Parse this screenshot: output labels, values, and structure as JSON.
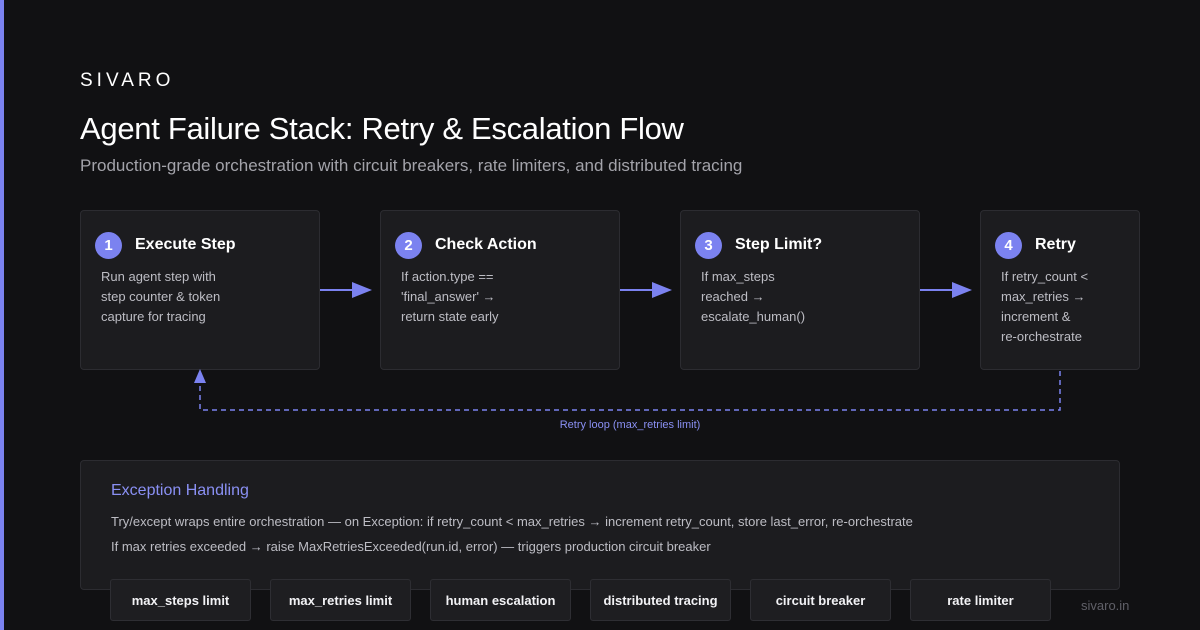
{
  "brand": "SIVARO",
  "title": "Agent Failure Stack: Retry & Escalation Flow",
  "subtitle": "Production-grade orchestration with circuit breakers, rate limiters, and distributed tracing",
  "colors": {
    "background": "#111113",
    "accent": "#7b82f0",
    "card": "#1c1c1f"
  },
  "steps": [
    {
      "number": "1",
      "title": "Execute Step",
      "lines": [
        "Run agent step with",
        "step counter & token",
        "capture for tracing"
      ]
    },
    {
      "number": "2",
      "title": "Check Action",
      "lines": [
        "If action.type ==",
        "'final_answer' →",
        "return state early"
      ]
    },
    {
      "number": "3",
      "title": "Step Limit?",
      "lines": [
        "If max_steps",
        "reached →",
        "escalate_human()"
      ]
    },
    {
      "number": "4",
      "title": "Retry",
      "lines": [
        "If retry_count <",
        "max_retries →",
        "increment &",
        "re-orchestrate"
      ]
    }
  ],
  "loop_label": "Retry loop (max_retries limit)",
  "exception": {
    "title": "Exception Handling",
    "lines": [
      "Try/except wraps entire orchestration — on Exception: if retry_count < max_retries → increment retry_count, store last_error, re-orchestrate",
      "If max retries exceeded → raise MaxRetriesExceeded(run.id, error) — triggers production circuit breaker"
    ]
  },
  "tags": [
    "max_steps limit",
    "max_retries limit",
    "human escalation",
    "distributed tracing",
    "circuit breaker",
    "rate limiter"
  ],
  "footer": "sivaro.in"
}
